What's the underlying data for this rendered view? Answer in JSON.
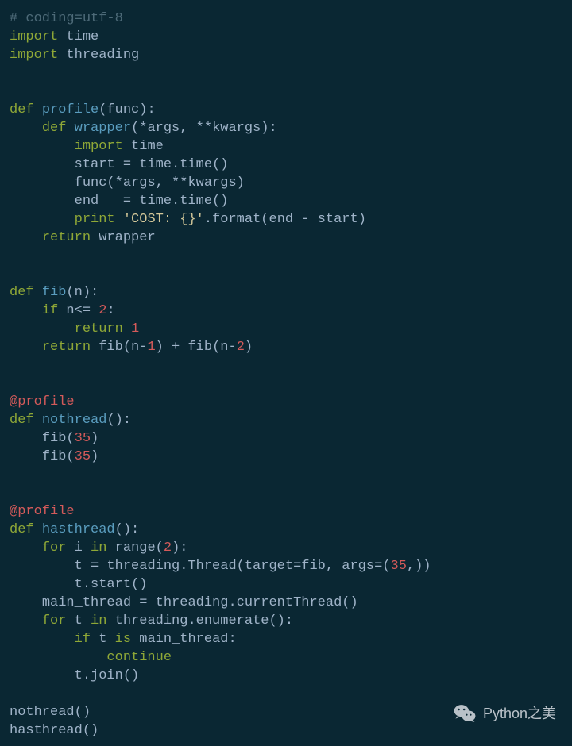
{
  "code": {
    "comment_line": "# coding=utf-8",
    "import1_kw": "import",
    "import1_mod": " time",
    "import2_kw": "import",
    "import2_mod": " threading",
    "profile_def_kw": "def ",
    "profile_def_name": "profile",
    "profile_def_paren_open": "(",
    "profile_def_param": "func",
    "profile_def_paren_close": "):",
    "wrapper_def_kw": "def ",
    "wrapper_def_name": "wrapper",
    "wrapper_def_args": "(*args, **kwargs):",
    "inner_import_kw": "import",
    "inner_import_mod": " time",
    "start_assign": "start = time.time()",
    "func_call": "func(*args, **kwargs)",
    "end_assign": "end   = time.time()",
    "print_kw": "print ",
    "print_str": "'COST: {}'",
    "print_fmt": ".format(end - start)",
    "return_wrapper_kw": "return",
    "return_wrapper_val": " wrapper",
    "fib_def_kw": "def ",
    "fib_def_name": "fib",
    "fib_def_paren_open": "(",
    "fib_def_param": "n",
    "fib_def_paren_close": "):",
    "if_kw": "if",
    "if_cond_a": " n<= ",
    "if_cond_num": "2",
    "if_cond_colon": ":",
    "return1_kw": "return ",
    "return1_num": "1",
    "return2_kw": "return",
    "return2_a": " fib(n-",
    "return2_n1": "1",
    "return2_b": ") + fib(n-",
    "return2_n2": "2",
    "return2_c": ")",
    "decorator1": "@profile",
    "nothread_def_kw": "def ",
    "nothread_def_name": "nothread",
    "nothread_def_rest": "():",
    "nothread_body1a": "fib(",
    "nothread_body1n": "35",
    "nothread_body1b": ")",
    "nothread_body2a": "fib(",
    "nothread_body2n": "35",
    "nothread_body2b": ")",
    "decorator2": "@profile",
    "hasthread_def_kw": "def ",
    "hasthread_def_name": "hasthread",
    "hasthread_def_rest": "():",
    "for1_kw": "for",
    "for1_var": " i ",
    "for1_in": "in",
    "for1_rest_a": " range(",
    "for1_rest_num": "2",
    "for1_rest_b": "):",
    "thread_line_a": "t = threading.Thread(target=fib, args=(",
    "thread_line_num": "35",
    "thread_line_b": ",))",
    "start_line": "t.start()",
    "main_thread_line": "main_thread = threading.currentThread()",
    "for2_kw": "for",
    "for2_var": " t ",
    "for2_in": "in",
    "for2_rest": " threading.enumerate():",
    "if2_kw": "if",
    "if2_a": " t ",
    "if2_is": "is",
    "if2_b": " main_thread:",
    "continue_kw": "continue",
    "join_line": "t.join()",
    "call_nothread": "nothread()",
    "call_hasthread": "hasthread()"
  },
  "watermark": {
    "text": "Python之美"
  }
}
